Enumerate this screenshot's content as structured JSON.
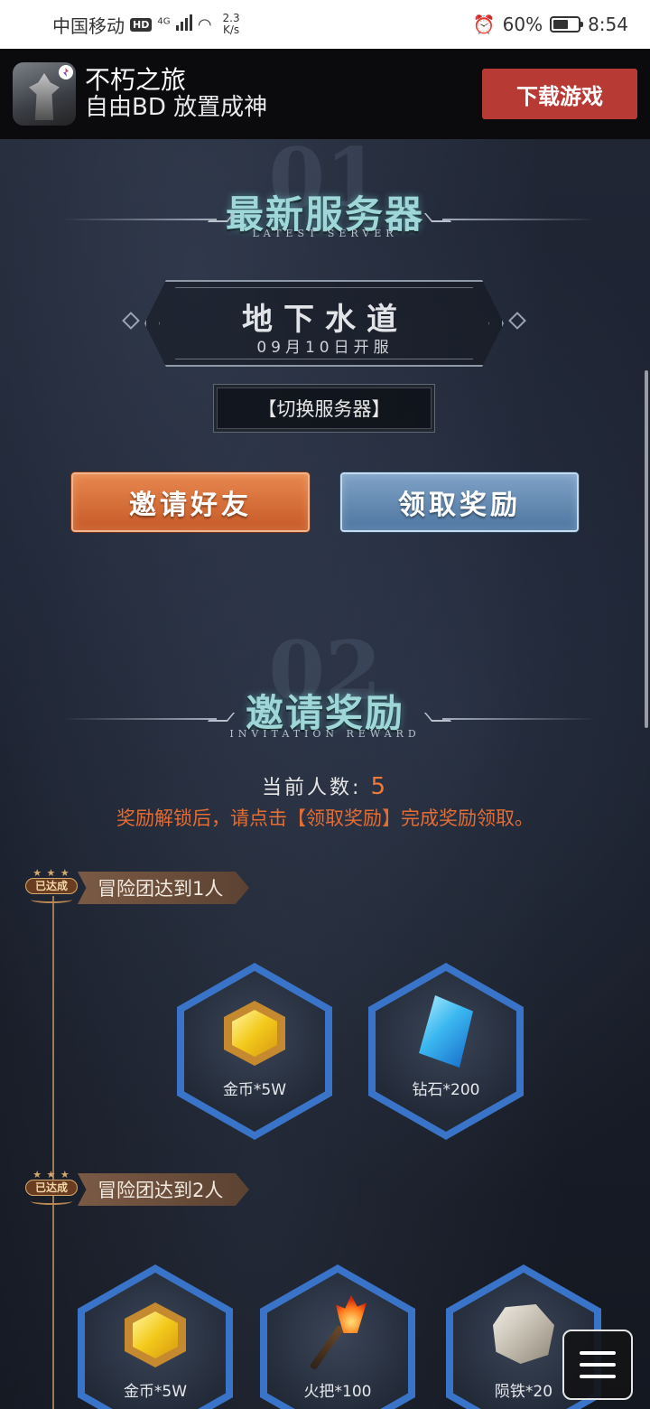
{
  "status_bar": {
    "carrier": "中国移动",
    "hd": "HD",
    "network": "4G",
    "speed_value": "2.3",
    "speed_unit": "K/s",
    "battery": "60%",
    "time": "8:54"
  },
  "banner": {
    "app_name": "不朽之旅",
    "tagline": "自由BD 放置成神",
    "download_label": "下载游戏"
  },
  "section1": {
    "number": "01",
    "title": "最新服务器",
    "subtitle": "LATEST SERVER",
    "server_name": "地下水道",
    "server_date": "09月10日开服",
    "switch_label": "【切换服务器】",
    "invite_label": "邀请好友",
    "claim_label": "领取奖励"
  },
  "section2": {
    "number": "02",
    "title": "邀请奖励",
    "subtitle": "INVITATION REWARD",
    "count_label": "当前人数:",
    "count_value": "5",
    "notice": "奖励解锁后，请点击【领取奖励】完成奖励领取。"
  },
  "milestones": [
    {
      "badge": "已达成",
      "label": "冒险团达到1人",
      "rewards": [
        {
          "icon": "gold-coin-icon",
          "label": "金币*5W"
        },
        {
          "icon": "diamond-icon",
          "label": "钻石*200"
        }
      ]
    },
    {
      "badge": "已达成",
      "label": "冒险团达到2人",
      "rewards": [
        {
          "icon": "gold-coin-icon",
          "label": "金币*5W"
        },
        {
          "icon": "torch-icon",
          "label": "火把*100"
        },
        {
          "icon": "meteorite-icon",
          "label": "陨铁*20"
        }
      ]
    }
  ],
  "colors": {
    "accent_orange": "#e26d35",
    "download_red": "#b83a34",
    "hex_glow_blue": "#3a74c9"
  }
}
